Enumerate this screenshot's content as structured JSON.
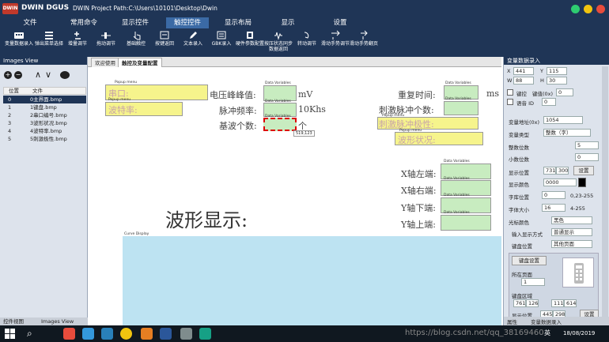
{
  "titlebar": {
    "logo_text": "DWIN",
    "app_name": "DWIN DGUS",
    "project_path": "DWIN Project Path:C:\\Users\\10101\\Desktop\\Dwin"
  },
  "menu": [
    "文件",
    "常用命令",
    "显示控件",
    "触控控件",
    "显示布局",
    "显示",
    "设置"
  ],
  "toolbar": [
    "变量数据录入",
    "弹出菜单选择",
    "增量调节",
    "拖动调节",
    "基础触控",
    "按键返回",
    "文本录入",
    "GBK录入",
    "硬件参数配置",
    "按压状态同步数据返回",
    "转动调节",
    "滑动手势调节",
    "滑动手势翻页"
  ],
  "images_view": {
    "title": "Images View",
    "col_pos": "位置",
    "col_file": "文件",
    "rows": [
      {
        "pos": "0",
        "file": "0主界面.bmp"
      },
      {
        "pos": "1",
        "file": "1键盘.bmp"
      },
      {
        "pos": "2",
        "file": "2串口编号.bmp"
      },
      {
        "pos": "3",
        "file": "3波形状况.bmp"
      },
      {
        "pos": "4",
        "file": "4波特率.bmp"
      },
      {
        "pos": "5",
        "file": "5刺激极性.bmp"
      }
    ],
    "bottom_tab_1": "控件视图",
    "bottom_tab_2": "Images View"
  },
  "editor": {
    "tabs": [
      "欢迎使用",
      "触控及变量配置"
    ],
    "tag_popup": "Popup menu",
    "tag_data": "Data Variables",
    "tag_curve": "Curve Display",
    "popups": {
      "serial": "串口:",
      "baud": "波特率:",
      "polarity": "刺激脉冲极性:",
      "wave_status": "波形状况:"
    },
    "labels": {
      "peak": "电压峰峰值:",
      "freq": "脉冲频率:",
      "count": "基波个数:",
      "repeat": "重复时间:",
      "stim_count": "刺激脉冲个数:",
      "x_left": "X轴左端:",
      "x_right": "X轴右端:",
      "y_lower": "Y轴下端:",
      "y_upper": "Y轴上端:",
      "wave_display": "波形显示:"
    },
    "units": {
      "mv": "mV",
      "khs": "10Khs",
      "ge": "个",
      "ms": "ms"
    },
    "tooltip": "519,123"
  },
  "properties": {
    "title": "变量数据录入",
    "x": "441",
    "y": "115",
    "w": "88",
    "h": "30",
    "x_label": "X",
    "y_label": "Y",
    "w_label": "W",
    "h_label": "H",
    "keycode_label": "键控",
    "keycode_value_label": "键值(0x)",
    "keycode_value": "0",
    "voice_label": "语音 ID",
    "voice_id": "0",
    "var_addr_label": "变量地址(0x)",
    "var_addr": "1054",
    "var_type_label": "变量类型",
    "var_type": "整数（字）",
    "int_digits_label": "整数位数",
    "int_digits": "5",
    "dec_digits_label": "小数位数",
    "dec_digits": "0",
    "disp_pos_label": "显示位置",
    "disp_x": "731",
    "disp_y": "300",
    "set_btn": "设置",
    "disp_color_label": "显示颜色",
    "disp_color_value": "0000",
    "disp_color": "#000000",
    "font_pos_label": "字库位置",
    "font_pos": "0",
    "font_pos_range": "0,23-255",
    "font_size_label": "字体大小",
    "font_size": "16",
    "font_size_range": "4-255",
    "cursor_color_label": "光标颜色",
    "cursor_color": "黑色",
    "input_mode_label": "输入显示方式",
    "input_mode": "普通显示",
    "keyboard_pos_label": "键盘位置",
    "keyboard_pos": "其他页面",
    "keyboard_setup_btn": "键盘设置",
    "page_label": "所在页面",
    "page": "1",
    "kb_area_label": "键盘区域",
    "kb_x": "761",
    "kb_y": "126",
    "kb_x2": "1116",
    "kb_y2": "614",
    "disp_at_label": "显示位置",
    "disp_at_x": "445",
    "disp_at_y": "298",
    "set_btn2": "设置",
    "bottom_tab_1": "属性",
    "bottom_tab_2": "变量数据录入"
  },
  "taskbar": {
    "watermark": "https://blog.csdn.net/qq_38169460",
    "time": "18/08/2019",
    "lang": "英"
  }
}
